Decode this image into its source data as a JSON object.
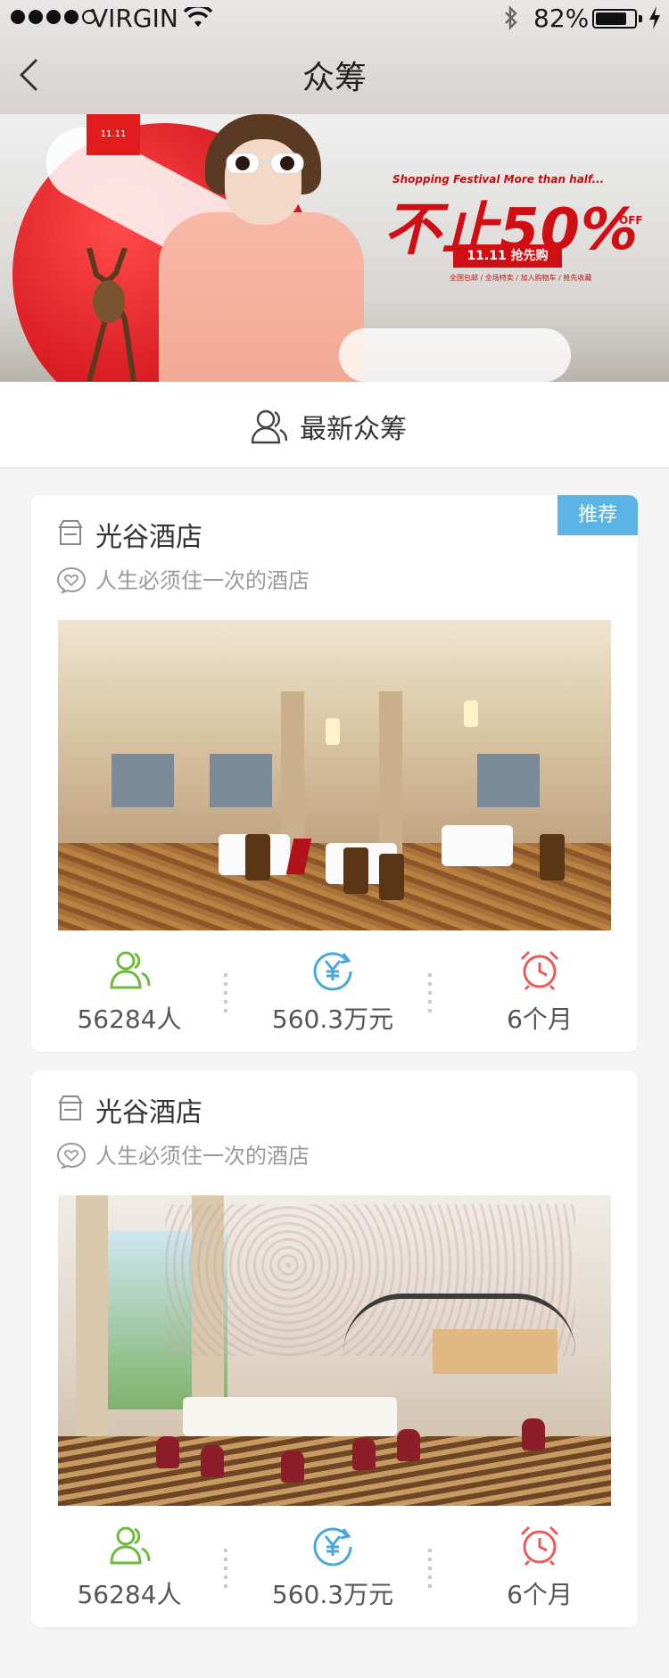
{
  "status_bar": {
    "carrier": "VIRGIN",
    "battery_percent": "82%",
    "battery_level": 0.82
  },
  "nav": {
    "title": "众筹",
    "back_icon": "chevron-left-icon"
  },
  "banner": {
    "logo_text": "11.11",
    "promo_small": "Shopping Festival  More than half...",
    "promo_big": "不止50%",
    "promo_off": "OFF",
    "promo_tag": "11.11 抢先购",
    "promo_sub": "全国包邮 / 全场特卖 / 加入购物车 / 抢先收藏"
  },
  "section": {
    "title": "最新众筹",
    "icon": "users-icon"
  },
  "cards": [
    {
      "badge": "推荐",
      "title": "光谷酒店",
      "slogan": "人生必须住一次的酒店",
      "stats": [
        {
          "icon": "users-icon",
          "value": "56284人",
          "color": "#6dbb3c"
        },
        {
          "icon": "yen-icon",
          "value": "560.3万元",
          "color": "#4aa7dc"
        },
        {
          "icon": "alarm-clock-icon",
          "value": "6个月",
          "color": "#ea5a5a"
        }
      ]
    },
    {
      "badge": "",
      "title": "光谷酒店",
      "slogan": "人生必须住一次的酒店",
      "stats": [
        {
          "icon": "users-icon",
          "value": "56284人",
          "color": "#6dbb3c"
        },
        {
          "icon": "yen-icon",
          "value": "560.3万元",
          "color": "#4aa7dc"
        },
        {
          "icon": "alarm-clock-icon",
          "value": "6个月",
          "color": "#ea5a5a"
        }
      ]
    }
  ],
  "colors": {
    "accent_badge": "#5bb3e6",
    "green": "#6dbb3c",
    "blue": "#4aa7dc",
    "red": "#ea5a5a"
  }
}
